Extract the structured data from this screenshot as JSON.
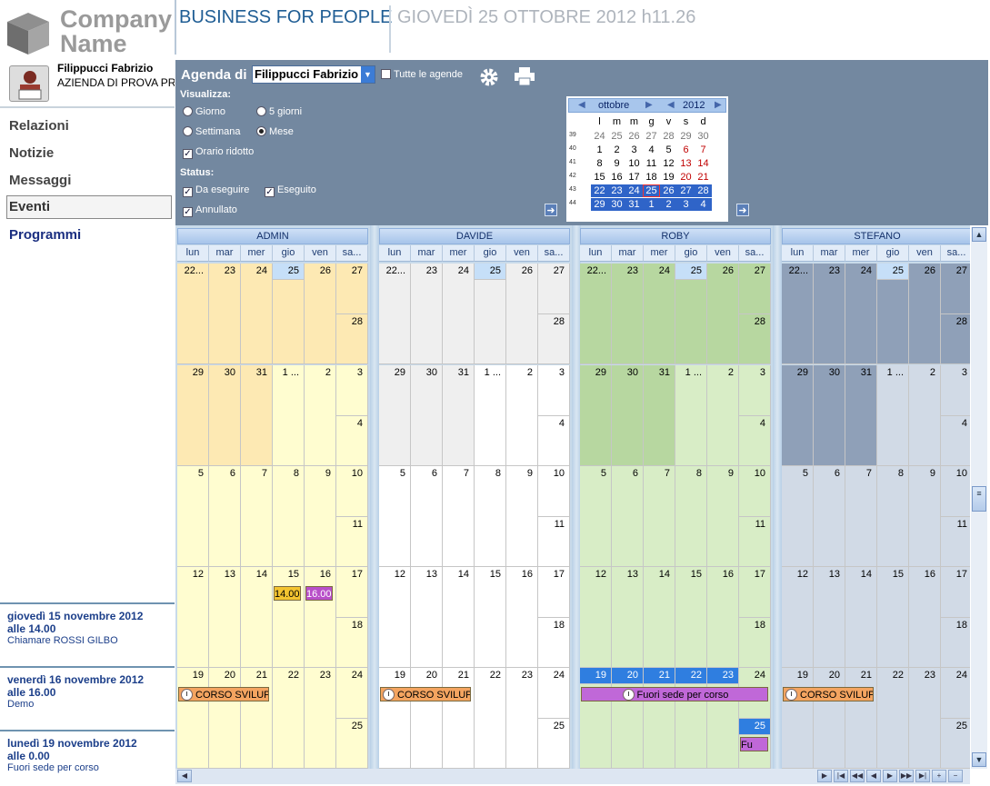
{
  "header": {
    "company_name": "Company\nName",
    "tagline": "BUSINESS FOR PEOPLE",
    "datetime": "GIOVEDÌ 25 OTTOBRE 2012 h11.26"
  },
  "user": {
    "name": "Filippucci Fabrizio",
    "company": "AZIENDA DI PROVA PR",
    "avatar_badge": "Name"
  },
  "nav": {
    "items": [
      {
        "label": "Relazioni"
      },
      {
        "label": "Notizie"
      },
      {
        "label": "Messaggi"
      },
      {
        "label": "Eventi"
      },
      {
        "label": "Programmi"
      }
    ],
    "selected": "Eventi"
  },
  "upcoming": [
    {
      "date": "giovedì 15 novembre 2012",
      "time": "alle 14.00",
      "note": "Chiamare ROSSI GILBO"
    },
    {
      "date": "venerdì 16 novembre 2012",
      "time": "alle 16.00",
      "note": "Demo"
    },
    {
      "date": "lunedì 19 novembre 2012",
      "time": "alle 0.00",
      "note": "Fuori sede per corso"
    }
  ],
  "toolbar": {
    "agenda_label": "Agenda di",
    "agenda_value": "Filippucci Fabrizio",
    "all_agendas_label": "Tutte le agende",
    "visualizza_label": "Visualizza:",
    "views": [
      {
        "label": "Giorno",
        "selected": false
      },
      {
        "label": "5 giorni",
        "selected": false
      },
      {
        "label": "Settimana",
        "selected": false
      },
      {
        "label": "Mese",
        "selected": true
      }
    ],
    "reduced_hours_label": "Orario ridotto",
    "status_label": "Status:",
    "status": [
      {
        "label": "Da eseguire",
        "checked": true
      },
      {
        "label": "Eseguito",
        "checked": true
      },
      {
        "label": "Annullato",
        "checked": true
      }
    ]
  },
  "mini_calendar": {
    "month": "ottobre",
    "year": "2012",
    "weekdays": [
      "l",
      "m",
      "m",
      "g",
      "v",
      "s",
      "d"
    ],
    "weeks": [
      {
        "num": "39",
        "days": [
          "24",
          "25",
          "26",
          "27",
          "28",
          "29",
          "30"
        ]
      },
      {
        "num": "40",
        "days": [
          "1",
          "2",
          "3",
          "4",
          "5",
          "6",
          "7"
        ]
      },
      {
        "num": "41",
        "days": [
          "8",
          "9",
          "10",
          "11",
          "12",
          "13",
          "14"
        ]
      },
      {
        "num": "42",
        "days": [
          "15",
          "16",
          "17",
          "18",
          "19",
          "20",
          "21"
        ]
      },
      {
        "num": "43",
        "days": [
          "22",
          "23",
          "24",
          "25",
          "26",
          "27",
          "28"
        ]
      },
      {
        "num": "44",
        "days": [
          "29",
          "30",
          "31",
          "1",
          "2",
          "3",
          "4"
        ]
      }
    ],
    "today": "25"
  },
  "calendar": {
    "resources": [
      "ADMIN",
      "DAVIDE",
      "ROBY",
      "STEFANO"
    ],
    "day_headers": [
      "lun",
      "mar",
      "mer",
      "gio",
      "ven",
      "sa..."
    ],
    "weeks": [
      [
        "22...",
        "23",
        "24",
        "25",
        "26",
        "27",
        "28"
      ],
      [
        "29",
        "30",
        "31",
        "1 ...",
        "2",
        "3",
        "4"
      ],
      [
        "5",
        "6",
        "7",
        "8",
        "9",
        "10",
        "11"
      ],
      [
        "12",
        "13",
        "14",
        "15",
        "16",
        "17",
        "18"
      ],
      [
        "19",
        "20",
        "21",
        "22",
        "23",
        "24",
        "25"
      ]
    ],
    "appointments": {
      "admin_thu": "14.00",
      "admin_fri": "16.00",
      "corso_admin": "CORSO SVILUPPO",
      "corso_davide": "CORSO SVILUPPO",
      "corso_stefano": "CORSO SVILUPPO",
      "roby_fuori": "Fuori sede per corso",
      "roby_sun": "Fu"
    }
  },
  "colors": {
    "admin_past": "#fde9b3",
    "admin": "#fffdd0",
    "davide_past": "#efefef",
    "davide": "#ffffff",
    "roby_past": "#b7d7a0",
    "roby": "#d8edc6",
    "stefano_past": "#8fa0b8",
    "stefano": "#d1dae6",
    "topbar": "#7388a0",
    "highlight": "#2f7ee0"
  }
}
